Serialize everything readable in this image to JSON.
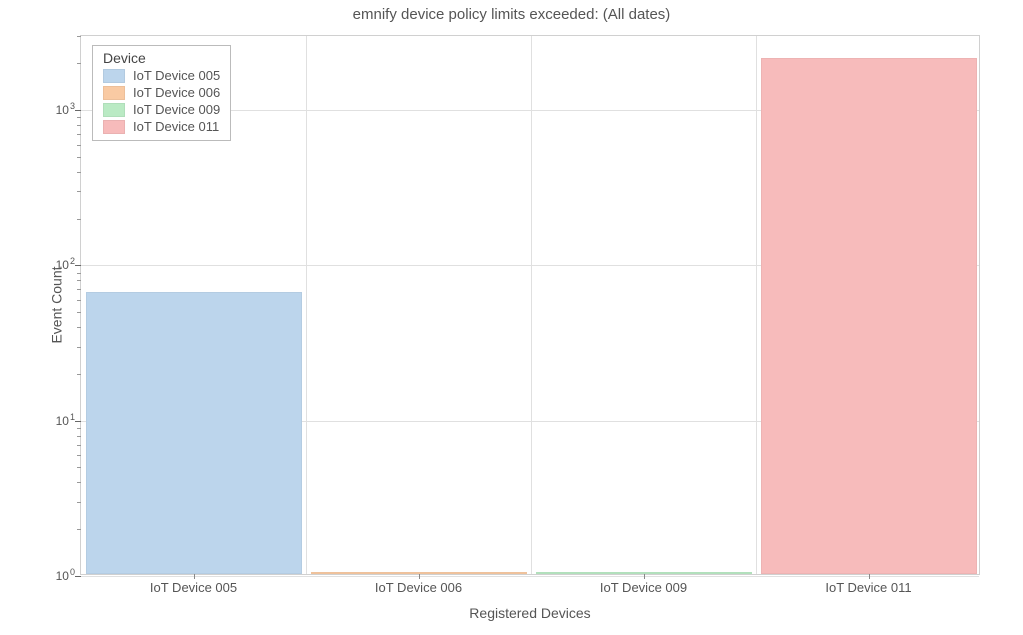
{
  "chart_data": {
    "type": "bar",
    "title": "emnify device policy limits exceeded: (All dates)",
    "xlabel": "Registered Devices",
    "ylabel": "Event Count",
    "yscale": "log",
    "ylim": [
      1,
      3000
    ],
    "categories": [
      "IoT Device 005",
      "IoT Device 006",
      "IoT Device 009",
      "IoT Device 011"
    ],
    "series": [
      {
        "name": "IoT Device 005",
        "color": "#bcd5ec",
        "values": [
          65,
          null,
          null,
          null
        ]
      },
      {
        "name": "IoT Device 006",
        "color": "#f9caa3",
        "values": [
          null,
          1,
          null,
          null
        ]
      },
      {
        "name": "IoT Device 009",
        "color": "#baeac4",
        "values": [
          null,
          null,
          1,
          null
        ]
      },
      {
        "name": "IoT Device 011",
        "color": "#f7bbbb",
        "values": [
          null,
          null,
          null,
          2100
        ]
      }
    ],
    "legend": {
      "title": "Device",
      "position": "upper-left"
    }
  }
}
